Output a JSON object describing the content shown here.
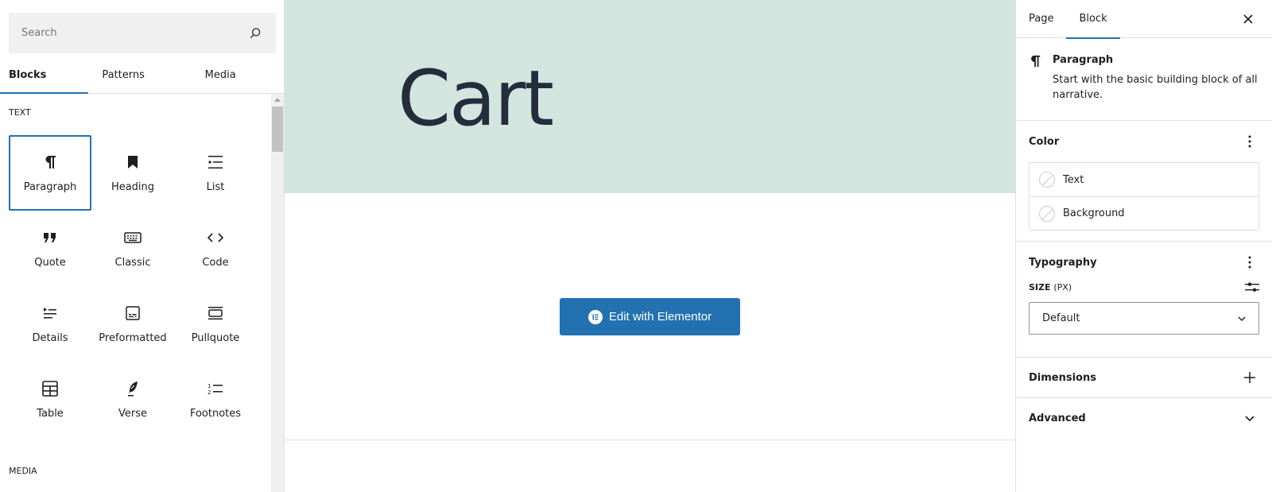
{
  "inserter": {
    "search": {
      "placeholder": "Search",
      "value": ""
    },
    "tabs": [
      {
        "label": "Blocks",
        "active": true
      },
      {
        "label": "Patterns",
        "active": false
      },
      {
        "label": "Media",
        "active": false
      }
    ],
    "categories": [
      {
        "label": "TEXT",
        "blocks": [
          {
            "label": "Paragraph",
            "icon": "paragraph-icon",
            "selected": true
          },
          {
            "label": "Heading",
            "icon": "heading-icon"
          },
          {
            "label": "List",
            "icon": "list-icon"
          },
          {
            "label": "Quote",
            "icon": "quote-icon"
          },
          {
            "label": "Classic",
            "icon": "keyboard-icon"
          },
          {
            "label": "Code",
            "icon": "code-icon"
          },
          {
            "label": "Details",
            "icon": "details-icon"
          },
          {
            "label": "Preformatted",
            "icon": "preformatted-icon"
          },
          {
            "label": "Pullquote",
            "icon": "pullquote-icon"
          },
          {
            "label": "Table",
            "icon": "table-icon"
          },
          {
            "label": "Verse",
            "icon": "verse-icon"
          },
          {
            "label": "Footnotes",
            "icon": "footnotes-icon"
          }
        ]
      },
      {
        "label": "MEDIA",
        "blocks": []
      }
    ]
  },
  "canvas": {
    "hero_title": "Cart",
    "hero_bg": "#d3e5df",
    "edit_button_label": "Edit with Elementor",
    "accent": "#2271b1"
  },
  "sidebar": {
    "tabs": [
      {
        "label": "Page",
        "active": false
      },
      {
        "label": "Block",
        "active": true
      }
    ],
    "block_card": {
      "title": "Paragraph",
      "description": "Start with the basic building block of all narrative."
    },
    "color": {
      "title": "Color",
      "items": [
        {
          "label": "Text"
        },
        {
          "label": "Background"
        }
      ]
    },
    "typography": {
      "title": "Typography",
      "size_label": "SIZE",
      "size_unit": "(PX)",
      "size_value": "Default"
    },
    "dimensions": {
      "title": "Dimensions"
    },
    "advanced": {
      "title": "Advanced"
    }
  }
}
